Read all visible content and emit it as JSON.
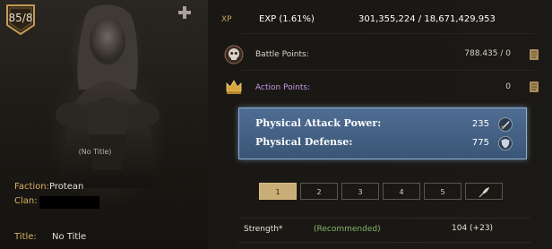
{
  "character": {
    "level": "85/8",
    "title": "(No Title)",
    "faction_label": "Faction:",
    "faction_value": "Protean",
    "clan_label": "Clan:",
    "title_label": "Title:",
    "title_value": "No Title"
  },
  "xp": {
    "label": "XP",
    "percent": "EXP (1.61%)",
    "value": "301,355,224 / 18,671,429,953"
  },
  "stats": [
    {
      "label": "Battle Points:",
      "value": "788.435 / 0",
      "label_color": "#c8c2b6",
      "icon": "skull-icon"
    },
    {
      "label": "Action Points:",
      "value": "0",
      "label_color": "#c796e6",
      "icon": "crown-icon"
    }
  ],
  "physical": [
    {
      "label": "Physical Attack Power:",
      "value": "235",
      "icon": "sword-icon"
    },
    {
      "label": "Physical Defense:",
      "value": "775",
      "icon": "shield-icon"
    }
  ],
  "pages": [
    "1",
    "2",
    "3",
    "4",
    "5"
  ],
  "active_page": 0,
  "strength": {
    "label": "Strength*",
    "recommended": "(Recommended)",
    "value": "104 (+23)"
  },
  "colors": {
    "accent_gold": "#c7a35d",
    "highlight_blue": "#4f6d93",
    "recommended_green": "#85b46a"
  }
}
